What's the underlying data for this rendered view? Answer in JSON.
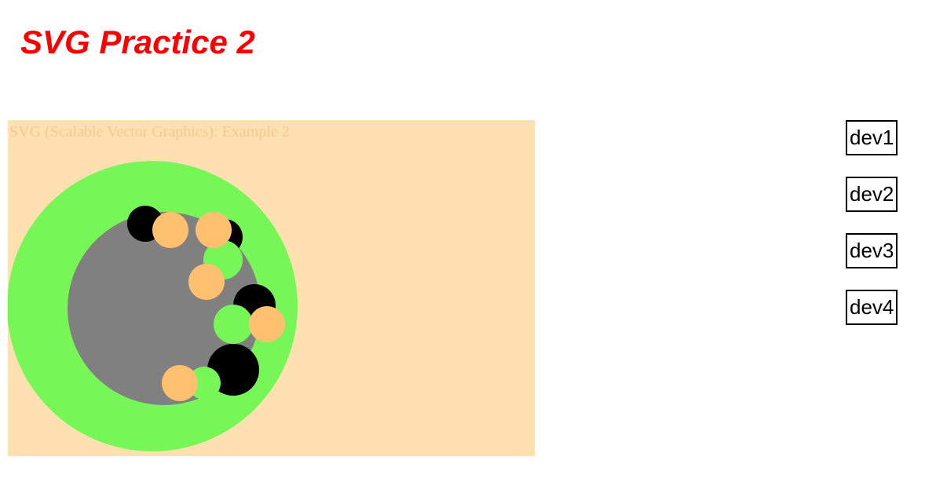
{
  "page": {
    "title": "SVG Practice 2",
    "title_color": "#ff0000"
  },
  "svg_demo": {
    "caption": "SVG (Scalable Vector Graphics): Example 2",
    "caption_color": "#f5c890",
    "background_color": "#ffe0b0",
    "colors": {
      "green": "#77f757",
      "gray": "#808080",
      "black": "#000000",
      "orange": "#ffc070"
    }
  },
  "devs": [
    {
      "label": "dev1"
    },
    {
      "label": "dev2"
    },
    {
      "label": "dev3"
    },
    {
      "label": "dev4"
    }
  ]
}
